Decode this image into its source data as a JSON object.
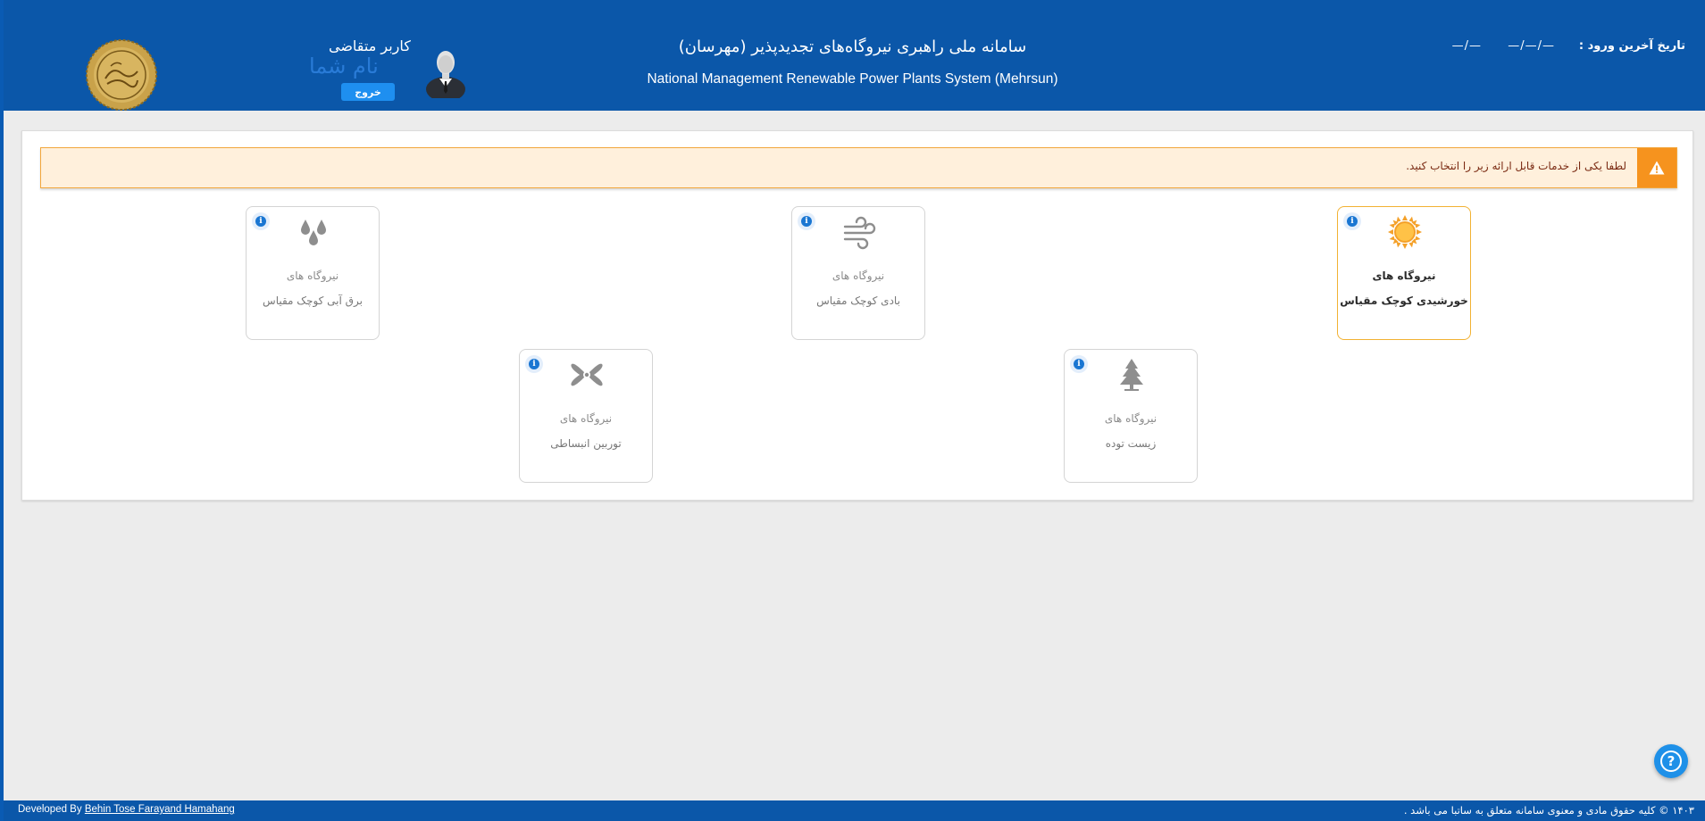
{
  "header": {
    "last_login_label": "تاریخ آخرین ورود :",
    "last_login_date": "—/—/—",
    "last_login_time": "—/—",
    "title_fa": "سامانه ملی راهبری نیروگاه‌های تجدیدپذیر (مهرسان)",
    "title_en": "National Management Renewable Power Plants System (Mehrsun)",
    "user_role": "کاربر متقاضی",
    "user_name": "نام شما",
    "logout_label": "خروج",
    "colors": {
      "bar": "#0b57a9",
      "logout": "#1e8ff0"
    },
    "icons": {
      "avatar": "user-avatar-icon",
      "seal": "ministry-seal-icon"
    }
  },
  "alert": {
    "text": "لطفا یکی از خدمات قابل ارائه زیر را انتخاب کنید.",
    "icon": "warning-icon",
    "colors": {
      "bg": "#fff0dc",
      "border": "#f2a63b",
      "icon_bg": "#f6931e",
      "text": "#7a2a12"
    }
  },
  "services": [
    {
      "line1": "نیروگاه های",
      "line2": "خورشیدی کوچک مقیاس",
      "icon": "sun-icon",
      "active": true
    },
    {
      "line1": "نیروگاه های",
      "line2": "بادی کوچک مقیاس",
      "icon": "wind-icon",
      "active": false
    },
    {
      "line1": "نیروگاه های",
      "line2": "برق آبی کوچک مقیاس",
      "icon": "water-drops-icon",
      "active": false
    },
    {
      "line1": "نیروگاه های",
      "line2": "زیست توده",
      "icon": "tree-icon",
      "active": false
    },
    {
      "line1": "نیروگاه های",
      "line2": "توربین انبساطی",
      "icon": "turbine-fan-icon",
      "active": false
    }
  ],
  "help": {
    "icon": "help-icon",
    "symbol": "?"
  },
  "footer": {
    "developed_by_label": "Developed By",
    "developer_name": "Behin Tose Farayand Hamahang",
    "copyright": "۱۴۰۳ © کلیه حقوق مادی و معنوی سامانه متعلق به ساتبا می باشد ."
  }
}
